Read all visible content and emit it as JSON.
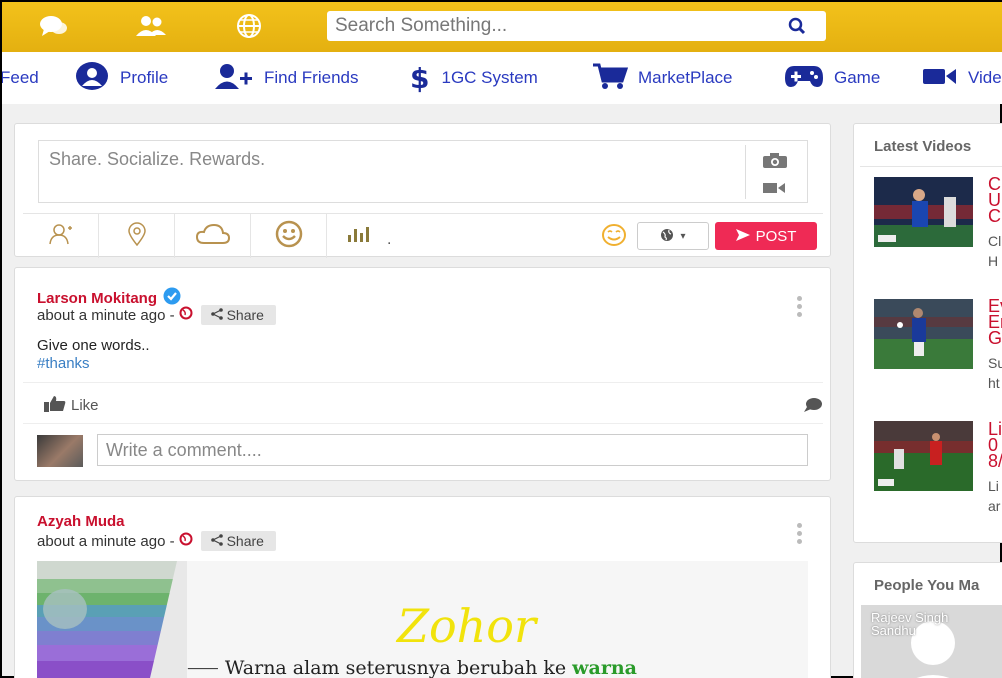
{
  "topbar": {
    "search_placeholder": "Search Something...",
    "icons": [
      "chat-bubbles-icon",
      "users-icon",
      "globe-icon"
    ]
  },
  "nav": {
    "items": [
      {
        "label": "Feed",
        "icon": "feed-icon"
      },
      {
        "label": "Profile",
        "icon": "user-circle-icon"
      },
      {
        "label": "Find Friends",
        "icon": "add-user-icon"
      },
      {
        "label": "1GC System",
        "icon": "dollar-icon"
      },
      {
        "label": "MarketPlace",
        "icon": "cart-icon"
      },
      {
        "label": "Game",
        "icon": "gamepad-icon"
      },
      {
        "label": "Video",
        "icon": "video-icon"
      }
    ]
  },
  "composer": {
    "placeholder": "Share. Socialize. Rewards.",
    "tool_dot": ".",
    "post_label": "POST"
  },
  "posts": [
    {
      "author": "Larson Mokitang",
      "verified": true,
      "time": "about a minute ago -",
      "share_label": "Share",
      "text": "Give one words..",
      "hashtag": "#thanks",
      "like_label": "Like",
      "comment_placeholder": "Write a comment...."
    },
    {
      "author": "Azyah Muda",
      "time": "about a minute ago -",
      "share_label": "Share",
      "image_title": "Zohor",
      "image_caption": "Warna alam seterusnya berubah ke",
      "image_caption_highlight": "warna"
    }
  ],
  "sidebar": {
    "latest_videos_title": "Latest Videos",
    "videos": [
      {
        "title": "C\nU\nC",
        "desc": "Cl\nH"
      },
      {
        "title": "Ev\nEr\nG",
        "desc": "Su\nht"
      },
      {
        "title": "Li\n0\n8/",
        "desc": "Li\nar"
      }
    ],
    "people_title": "People You Ma",
    "person_name": "Rajeev Singh Sandhu"
  },
  "colors": {
    "topbar": "#f0be18",
    "nav_text": "#2a3ac0",
    "author": "#c9102e",
    "post_button": "#ef2a55",
    "hashtag": "#3a7fc4"
  }
}
